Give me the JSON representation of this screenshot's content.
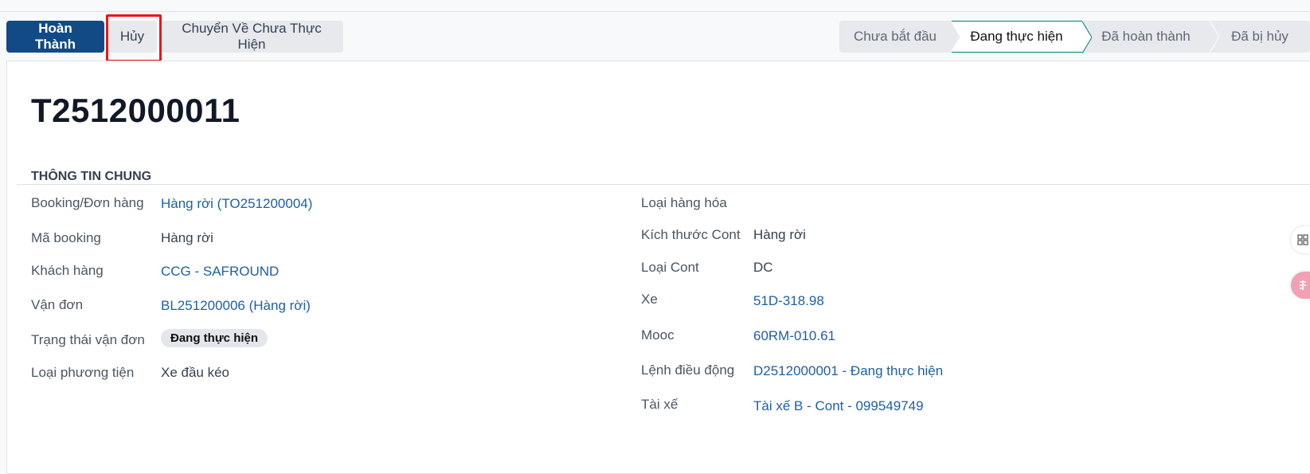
{
  "toolbar": {
    "complete_label": "Hoàn Thành",
    "cancel_label": "Hủy",
    "revert_label": "Chuyển Về Chưa Thực Hiện"
  },
  "statusbar": {
    "stages": [
      "Chưa bắt đầu",
      "Đang thực hiện",
      "Đã hoàn thành",
      "Đã bị hủy"
    ],
    "active": "Đang thực hiện"
  },
  "record": {
    "title": "T2512000011"
  },
  "section_title": "THÔNG TIN CHUNG",
  "left_fields": {
    "booking": {
      "label": "Booking/Đơn hàng",
      "value": "Hàng rời (TO251200004)"
    },
    "booking_code": {
      "label": "Mã booking",
      "value": "Hàng rời"
    },
    "customer": {
      "label": "Khách hàng",
      "value": "CCG - SAFROUND"
    },
    "bill": {
      "label": "Vận đơn",
      "value": "BL251200006 (Hàng rời)"
    },
    "bill_status": {
      "label": "Trạng thái vận đơn",
      "value": "Đang thực hiện"
    },
    "vehicle_type": {
      "label": "Loại phương tiện",
      "value": "Xe đầu kéo"
    }
  },
  "right_fields": {
    "goods_type": {
      "label": "Loại hàng hóa",
      "value": ""
    },
    "cont_size": {
      "label": "Kích thước Cont",
      "value": "Hàng rời"
    },
    "cont_type": {
      "label": "Loại Cont",
      "value": "DC"
    },
    "truck": {
      "label": "Xe",
      "value": "51D-318.98"
    },
    "trailer": {
      "label": "Mooc",
      "value": "60RM-010.61"
    },
    "dispatch": {
      "label": "Lệnh điều động",
      "value": "D2512000001 - Đang thực hiện"
    },
    "driver": {
      "label": "Tài xế",
      "value": "Tài xế B - Cont - 099549749"
    }
  },
  "colors": {
    "primary": "#124a85",
    "link": "#1d5fa8",
    "highlight": "#e81717",
    "active_stage_border": "#017e84"
  }
}
